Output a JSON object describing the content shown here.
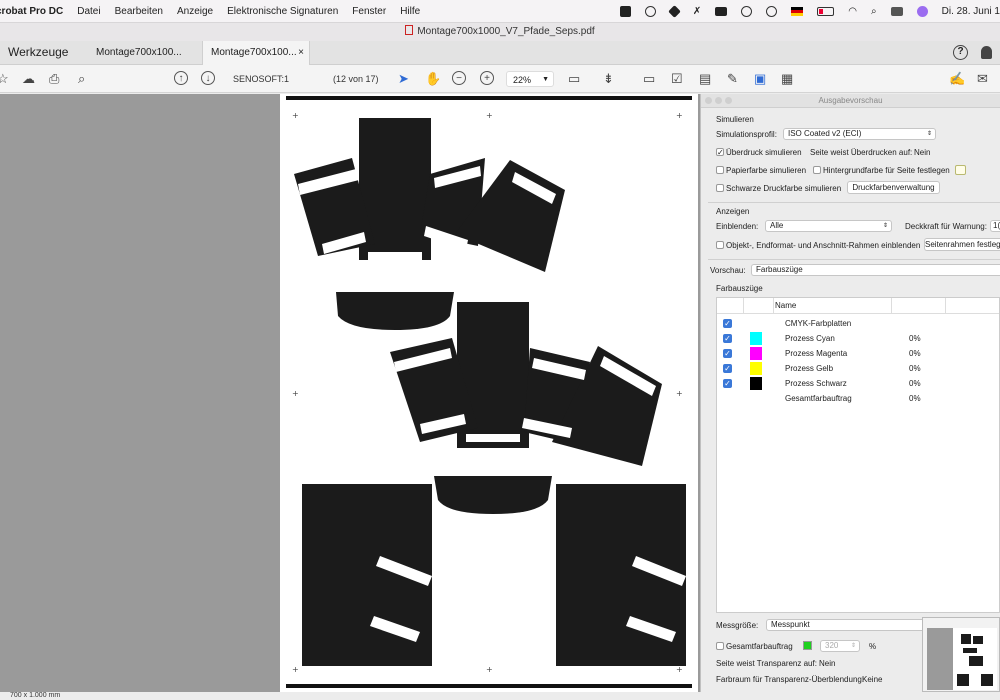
{
  "menubar": {
    "app_name": "crobat Pro DC",
    "items": [
      "Datei",
      "Bearbeiten",
      "Anzeige",
      "Elektronische Signaturen",
      "Fenster",
      "Hilfe"
    ],
    "datetime": "Di. 28. Juni 1"
  },
  "window": {
    "title": "Montage700x1000_V7_Pfade_Seps.pdf"
  },
  "tabs": {
    "tools_label": "Werkzeuge",
    "items": [
      {
        "label": "Montage700x100..."
      },
      {
        "label": "Montage700x100..."
      }
    ],
    "close_glyph": "×"
  },
  "toolbar": {
    "page_field": "SENOSOFT:1",
    "page_count": "(12 von 17)",
    "zoom": "22%"
  },
  "panel": {
    "title": "Ausgabevorschau",
    "simulate_header": "Simulieren",
    "profile_label": "Simulationsprofil:",
    "profile_value": "ISO Coated v2 (ECI)",
    "overprint_label": "Überdruck simulieren",
    "overprint_checked": true,
    "overprint_page_label": "Seite weist Überdrucken auf:",
    "overprint_page_value": "Nein",
    "paper_color_label": "Papierfarbe simulieren",
    "bg_color_label": "Hintergrundfarbe für Seite festlegen",
    "black_ink_label": "Schwarze Druckfarbe simulieren",
    "ink_manager_button": "Druckfarbenverwaltung",
    "show_header": "Anzeigen",
    "show_label": "Einblenden:",
    "show_value": "Alle",
    "opacity_label": "Deckkraft für Warnung:",
    "opacity_value": "1(",
    "frames_label": "Objekt-, Endformat- und Anschnitt-Rahmen einblenden",
    "page_frames_button": "Seitenrahmen festleg",
    "preview_label": "Vorschau:",
    "preview_value": "Farbauszüge",
    "separations_header": "Farbauszüge",
    "column_name": "Name",
    "separations": [
      {
        "name": "CMYK-Farbplatten",
        "percent": "",
        "color": "",
        "checked": true
      },
      {
        "name": "Prozess Cyan",
        "percent": "0%",
        "color": "#00ffff",
        "checked": true
      },
      {
        "name": "Prozess Magenta",
        "percent": "0%",
        "color": "#ff00ff",
        "checked": true
      },
      {
        "name": "Prozess Gelb",
        "percent": "0%",
        "color": "#ffff00",
        "checked": true
      },
      {
        "name": "Prozess Schwarz",
        "percent": "0%",
        "color": "#000000",
        "checked": true
      },
      {
        "name": "Gesamtfarbauftrag",
        "percent": "0%",
        "color": "",
        "checked": false
      }
    ],
    "sample_size_label": "Messgröße:",
    "sample_size_value": "Messpunkt",
    "total_coverage_label": "Gesamtfarbauftrag",
    "total_coverage_value": "320",
    "percent_sign": "%",
    "transparency_label": "Seite weist Transparenz auf:",
    "transparency_value": "Nein",
    "blend_space_label": "Farbraum für Transparenz-Überblendung:",
    "blend_space_value": "Keine"
  },
  "status": {
    "dimensions": "700 x 1.000 mm"
  },
  "colors": {
    "accent_blue": "#3a78d8",
    "coverage_green": "#1fd11f",
    "page_bg": "#9a9a9a"
  }
}
